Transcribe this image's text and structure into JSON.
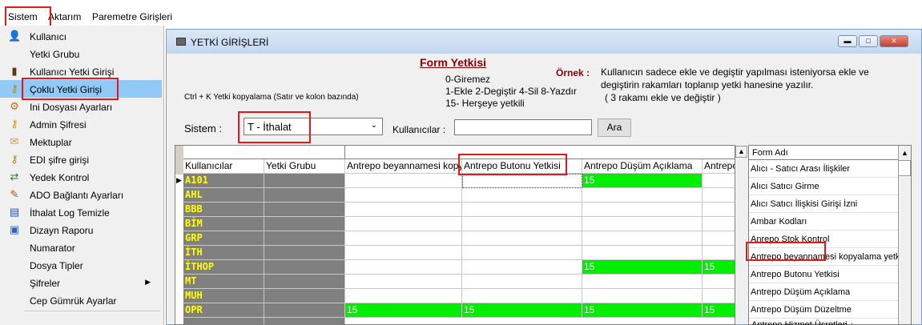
{
  "menubar": {
    "items": [
      "Sistem",
      "Aktarım",
      "Paremetre Girişleri"
    ]
  },
  "menu": {
    "items": [
      {
        "label": "Kullanıcı",
        "icon": "user-icon"
      },
      {
        "label": "Yetki Grubu",
        "icon": ""
      },
      {
        "label": "Kullanıcı Yetki Girişi",
        "icon": "user-key-icon"
      },
      {
        "label": "Çoklu Yetki Girişi",
        "icon": "keys-icon"
      },
      {
        "label": "Ini Dosyası Ayarları",
        "icon": "settings-file-icon"
      },
      {
        "label": "Admin Şifresi",
        "icon": "key-icon"
      },
      {
        "label": "Mektuplar",
        "icon": "letter-icon"
      },
      {
        "label": "EDI şifre girişi",
        "icon": "edi-key-icon"
      },
      {
        "label": "Yedek Kontrol",
        "icon": "backup-icon"
      },
      {
        "label": "ADO Bağlantı Ayarları",
        "icon": "connection-icon"
      },
      {
        "label": "İthalat Log Temizle",
        "icon": "log-icon"
      },
      {
        "label": "Dizayn Raporu",
        "icon": "report-icon"
      },
      {
        "label": "Numarator",
        "icon": ""
      },
      {
        "label": "Dosya Tipler",
        "icon": ""
      },
      {
        "label": "Şifreler",
        "icon": ""
      },
      {
        "label": "Cep Gümrük Ayarlar",
        "icon": ""
      }
    ],
    "submenu_arrow": "▶"
  },
  "window": {
    "title": "YETKİ GİRİŞLERİ",
    "form_title": "Form Yetkisi",
    "ornek_label": "Örnek :",
    "legend_lines": [
      "0-Giremez",
      "1-Ekle  2-Degiştir  4-Sil  8-Yazdır",
      "15- Herşeye yetkili"
    ],
    "example_text": [
      "Kullanıcın sadece ekle ve degiştir yapılması isteniyorsa  ekle ve",
      "degiştirin rakamları toplanıp yetki hanesine yazılır.",
      "( 3 rakamı ekle ve değiştir )"
    ],
    "copy_hint": "Ctrl + K Yetki kopyalama (Satır ve kolon bazında)",
    "sistem_label": "Sistem :",
    "sistem_value": "T - İthalat",
    "kullanicilar_label": "Kullanıcılar :",
    "kullanicilar_value": "",
    "search_button": "Ara"
  },
  "grid": {
    "columns": [
      "Kullanıcılar",
      "Yetki Grubu",
      "Antrepo beyannamesi kopyalam",
      "Antrepo Butonu Yetkisi",
      "Antrepo Düşüm Açıklama",
      "Antrepo"
    ],
    "rows": [
      {
        "user": "A101",
        "values": [
          "",
          "",
          "15",
          ""
        ]
      },
      {
        "user": "AHL",
        "values": [
          "",
          "",
          "",
          ""
        ]
      },
      {
        "user": "BBB",
        "values": [
          "",
          "",
          "",
          ""
        ]
      },
      {
        "user": "BİM",
        "values": [
          "",
          "",
          "",
          ""
        ]
      },
      {
        "user": "GRP",
        "values": [
          "",
          "",
          "",
          ""
        ]
      },
      {
        "user": "İTH",
        "values": [
          "",
          "",
          "",
          ""
        ]
      },
      {
        "user": "İTHOP",
        "values": [
          "",
          "",
          "15",
          "15"
        ]
      },
      {
        "user": "MT",
        "values": [
          "",
          "",
          "",
          ""
        ]
      },
      {
        "user": "MUH",
        "values": [
          "",
          "",
          "",
          ""
        ]
      },
      {
        "user": "OPR",
        "values": [
          "15",
          "15",
          "15",
          "15"
        ]
      }
    ]
  },
  "formlist": {
    "header": "Form Adı",
    "items": [
      "Alıcı - Satıcı Arası İlişkiler",
      "Alıcı Satıcı Girme",
      "Alıcı Satıcı İlişkisi Girişi İzni",
      "Ambar Kodları",
      "Anrepo Stok Kontrol",
      "Antrepo beyannamesi kopyalama yetkisi",
      "Antrepo Butonu Yetkisi",
      "Antrepo Düşüm Açıklama",
      "Antrepo Düşüm Düzeltme",
      "Antrepo Düzelt Kilit Yetkisi",
      "Antrepo Hizmet Ücretleri"
    ]
  },
  "colors": {
    "highlight": "#e8151b",
    "selection": "#91c9f7",
    "green": "#00ee00",
    "user_cell": "#808080",
    "user_text": "#ffff00"
  }
}
